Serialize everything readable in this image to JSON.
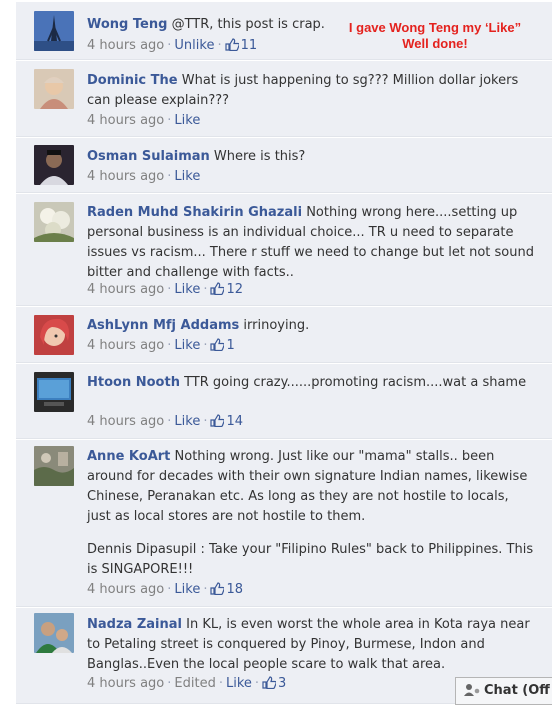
{
  "comments": [
    {
      "author": "Wong Teng",
      "text": "@TTR, this post is crap.",
      "time": "4 hours ago",
      "edited": "",
      "action": "Unlike",
      "likes": "11"
    },
    {
      "author": "Dominic The",
      "text": "What is just happening to sg??? Million dollar jokers can please explain???",
      "time": "4 hours ago",
      "edited": "",
      "action": "Like",
      "likes": ""
    },
    {
      "author": "Osman Sulaiman",
      "text": "Where is this?",
      "time": "4 hours ago",
      "edited": "",
      "action": "Like",
      "likes": ""
    },
    {
      "author": "Raden Muhd Shakirin Ghazali",
      "text": "Nothing wrong here....setting up personal business is an individual choice... TR u need to separate issues vs racism... There r stuff we need to change but let not sound bitter and challenge with facts..",
      "time": "4 hours ago",
      "edited": "",
      "action": "Like",
      "likes": "12"
    },
    {
      "author": "AshLynn Mfj Addams",
      "text": "irrinoying.",
      "time": "4 hours ago",
      "edited": "",
      "action": "Like",
      "likes": "1"
    },
    {
      "author": "Htoon Nooth",
      "text": "TTR going crazy......promoting racism....wat a shame",
      "time": "4 hours ago",
      "edited": "",
      "action": "Like",
      "likes": "14"
    },
    {
      "author": "Anne KoArt",
      "text": "Nothing wrong. Just like our \"mama\" stalls.. been around for decades with their own signature Indian names, likewise Chinese, Peranakan etc. As long as they are not hostile to locals, just as local stores are not hostile to them.",
      "text2": "Dennis Dipasupil : Take your \"Filipino Rules\" back to Philippines. This is SINGAPORE!!!",
      "time": "4 hours ago",
      "edited": "",
      "action": "Like",
      "likes": "18"
    },
    {
      "author": "Nadza Zainal",
      "text": "In KL, is even worst the whole area in Kota raya near to Petaling street is conquered by Pinoy, Burmese, Indon and Banglas..Even the local people scare to walk that area.",
      "time": "4 hours ago",
      "edited": "Edited",
      "action": "Like",
      "likes": "3"
    }
  ],
  "annotation": {
    "line1": "I gave Wong Teng my ‘Like”",
    "line2": "Well done!"
  },
  "chat": {
    "label": "Chat (Off"
  },
  "colors": {
    "author_link": "#3b5998",
    "comment_bg": "#edeff4",
    "annotation": "#e4221e"
  },
  "icons": [
    "thumbs-up-icon",
    "chat-person-icon"
  ]
}
